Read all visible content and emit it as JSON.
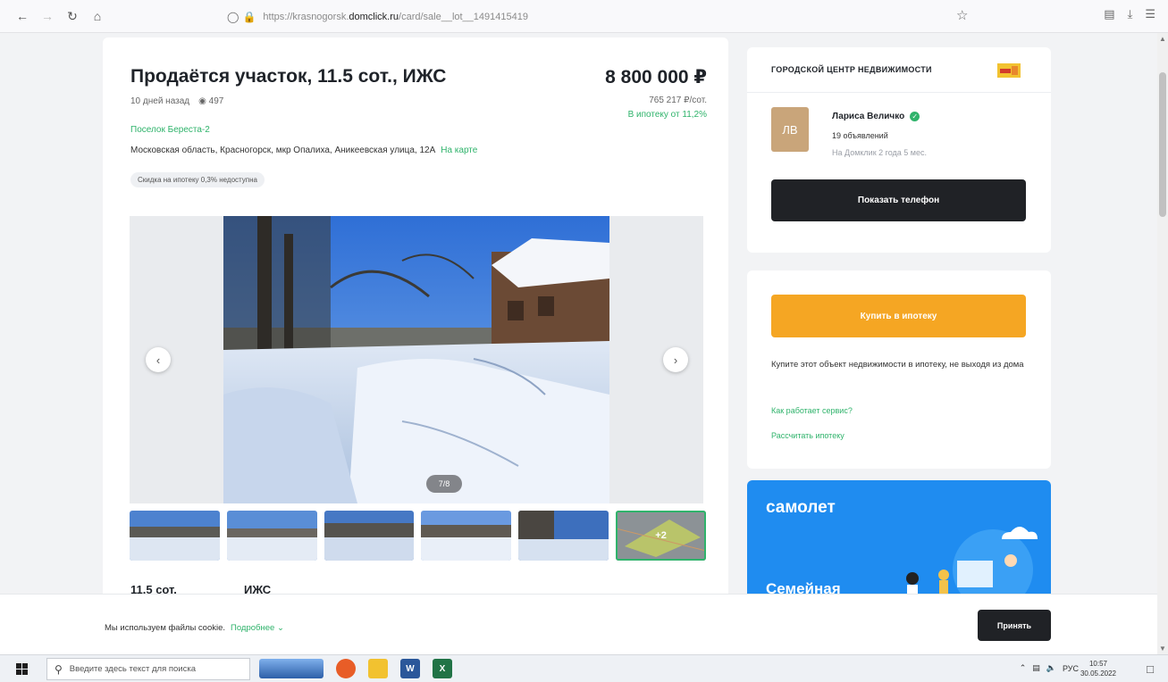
{
  "browser": {
    "url_prefix": "https://krasnogorsk.",
    "url_domain": "domclick.ru",
    "url_suffix": "/card/sale__lot__1491415419"
  },
  "listing": {
    "title": "Продаётся участок, 11.5 сот., ИЖС",
    "price": "8 800 000 ₽",
    "price_per": "765 217 ₽/сот.",
    "mortgage_from": "В ипотеку от 11,2%",
    "posted": "10 дней назад",
    "views": "497",
    "village": "Поселок Береста-2",
    "address": "Московская область, Красногорск, мкр Опалиха, Аникеевская улица, 12А",
    "map_link": "На карте",
    "discount_badge": "Скидка на ипотеку 0,3% недоступна",
    "photo_counter": "7/8",
    "more_photos": "+2",
    "area": "11.5 сот.",
    "land_type": "ИЖС"
  },
  "agency": {
    "name": "ГОРОДСКОЙ ЦЕНТР НЕДВИЖИМОСТИ",
    "agent_initials": "ЛВ",
    "agent_name": "Лариса Величко",
    "agent_ads": "19 объявлений",
    "agent_since": "На Домклик 2 года 5 мес.",
    "show_phone": "Показать телефон"
  },
  "mortgage": {
    "buy_button": "Купить в ипотеку",
    "description": "Купите этот объект недвижимости в ипотеку, не выходя из дома",
    "how_it_works": "Как работает сервис?",
    "calculate": "Рассчитать ипотеку"
  },
  "ad": {
    "brand": "самолет",
    "subtitle": "Семейная"
  },
  "cookie": {
    "text": "Мы используем файлы cookie.",
    "more": "Подробнее",
    "accept": "Принять"
  },
  "taskbar": {
    "search_placeholder": "Введите здесь текст для поиска",
    "lang": "РУС",
    "time": "10:57",
    "date": "30.05.2022"
  },
  "colors": {
    "accent_green": "#2fb36b",
    "orange": "#f5a623",
    "dark_button": "#202226",
    "ad_blue": "#1f8cf0"
  }
}
